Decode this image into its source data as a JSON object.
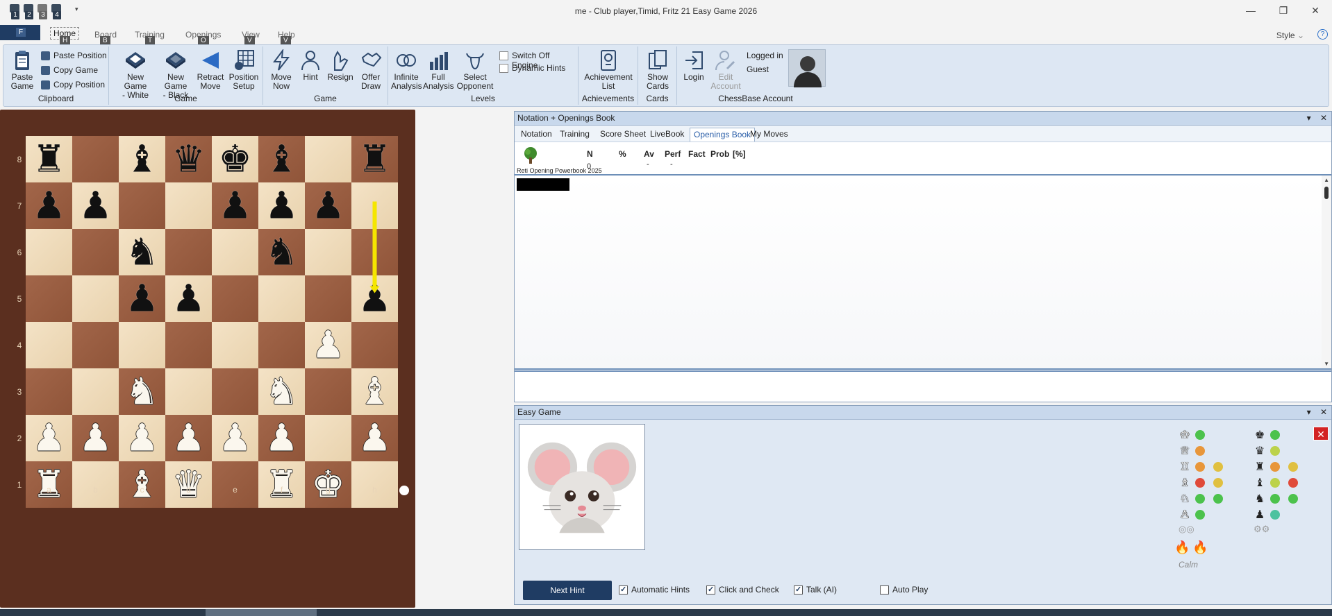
{
  "window": {
    "title": "me - Club player,Timid, Fritz 21 Easy Game 2026",
    "min_label": "—",
    "restore_label": "❐",
    "close_label": "✕"
  },
  "quick_access": [
    "1",
    "2",
    "3",
    "4"
  ],
  "ribbon_tabs": {
    "file_keytip": "F",
    "tabs": [
      {
        "label": "Home",
        "keytip": "H"
      },
      {
        "label": "Board",
        "keytip": "B"
      },
      {
        "label": "Training",
        "keytip": "T"
      },
      {
        "label": "Openings",
        "keytip": "O"
      },
      {
        "label": "View",
        "keytip": "V"
      },
      {
        "label": "Help",
        "keytip": "V"
      }
    ],
    "style_label": "Style",
    "style_chevron": "⌄",
    "help_label": "?"
  },
  "ribbon": {
    "clipboard": {
      "label": "Clipboard",
      "paste_game": [
        "Paste",
        "Game"
      ],
      "paste_position": "Paste Position",
      "copy_game": "Copy Game",
      "copy_position": "Copy Position"
    },
    "game": {
      "label": "Game",
      "new_white": [
        "New Game",
        "- White"
      ],
      "new_black": [
        "New Game",
        "- Black"
      ],
      "retract": [
        "Retract",
        "Move"
      ],
      "setup": [
        "Position",
        "Setup"
      ]
    },
    "game2": {
      "label": "Game",
      "move_now": [
        "Move",
        "Now"
      ],
      "hint": "Hint",
      "resign": "Resign",
      "offer_draw": [
        "Offer",
        "Draw"
      ]
    },
    "levels": {
      "label": "Levels",
      "infinite": [
        "Infinite",
        "Analysis"
      ],
      "full": [
        "Full",
        "Analysis"
      ],
      "select_opp": [
        "Select",
        "Opponent"
      ],
      "switch_off": "Switch Off Engine",
      "dynamic_hints": "Dynamic Hints"
    },
    "achievements": {
      "label": "Achievements",
      "list": [
        "Achievement",
        "List"
      ]
    },
    "cards": {
      "label": "Cards",
      "show": [
        "Show",
        "Cards"
      ]
    },
    "account": {
      "label": "ChessBase Account",
      "login": "Login",
      "edit": [
        "Edit",
        "Account"
      ],
      "logged_in": "Logged in",
      "user": "Guest"
    }
  },
  "board": {
    "ranks": [
      "8",
      "7",
      "6",
      "5",
      "4",
      "3",
      "2",
      "1"
    ],
    "files": [
      "a",
      "b",
      "c",
      "d",
      "e",
      "f",
      "g",
      "h"
    ],
    "position": [
      [
        "r",
        "",
        "b",
        "q",
        "k",
        "b",
        "",
        "r"
      ],
      [
        "p",
        "p",
        "",
        "",
        "p",
        "p",
        "p",
        ""
      ],
      [
        "",
        "",
        "n",
        "",
        "",
        "n",
        "",
        ""
      ],
      [
        "",
        "",
        "p",
        "p",
        "",
        "",
        "",
        "p"
      ],
      [
        "",
        "",
        "",
        "",
        "",
        "",
        "P",
        ""
      ],
      [
        "",
        "",
        "N",
        "",
        "",
        "N",
        "",
        "B"
      ],
      [
        "P",
        "P",
        "P",
        "P",
        "P",
        "P",
        "",
        "P"
      ],
      [
        "R",
        "",
        "B",
        "Q",
        "",
        "R",
        "K",
        ""
      ]
    ],
    "hint_arrow": {
      "from": "h7",
      "to": "h5",
      "color": "#f5e600"
    }
  },
  "notation_panel": {
    "title": "Notation + Openings Book",
    "tabs": [
      "Notation",
      "Training",
      "Score Sheet",
      "LiveBook",
      "Openings Book",
      "My Moves"
    ],
    "active_tab": "Openings Book",
    "columns": [
      "N",
      "%",
      "Av",
      "Perf",
      "Fact",
      "Prob",
      "[%]"
    ],
    "values": {
      "N": "0",
      "Av": "-",
      "Perf": "-"
    },
    "book_name": "Reti Opening Powerbook 2025"
  },
  "easy_panel": {
    "title": "Easy Game",
    "next_hint": "Next Hint",
    "options": [
      {
        "label": "Automatic Hints",
        "checked": true
      },
      {
        "label": "Click and Check",
        "checked": true
      },
      {
        "label": "Talk (AI)",
        "checked": true
      },
      {
        "label": "Auto Play",
        "checked": false
      }
    ],
    "mood": "Calm",
    "white_meter": [
      {
        "piece": "♔",
        "dots": [
          "#4cc24c"
        ]
      },
      {
        "piece": "♕",
        "dots": [
          "#e8963a"
        ]
      },
      {
        "piece": "♖",
        "dots": [
          "#e8963a",
          "#e0c040"
        ]
      },
      {
        "piece": "♗",
        "dots": [
          "#e04a3a",
          "#e0c040"
        ]
      },
      {
        "piece": "♘",
        "dots": [
          "#4cc24c",
          "#4cc24c"
        ]
      },
      {
        "piece": "♙",
        "dots": [
          "#4cc24c"
        ]
      }
    ],
    "black_meter": [
      {
        "piece": "♚",
        "dots": [
          "#4cc24c"
        ]
      },
      {
        "piece": "♛",
        "dots": [
          "#bcd24a"
        ]
      },
      {
        "piece": "♜",
        "dots": [
          "#e8963a",
          "#e0c040"
        ]
      },
      {
        "piece": "♝",
        "dots": [
          "#bcd24a",
          "#e04a3a"
        ]
      },
      {
        "piece": "♞",
        "dots": [
          "#4cc24c",
          "#4cc24c"
        ]
      },
      {
        "piece": "♟",
        "dots": [
          "#4cc2a0"
        ]
      }
    ],
    "flames": [
      "🔥",
      "🔥"
    ],
    "close_label": "✕"
  },
  "icons": {
    "paste": "clipboard-icon",
    "tree": "tree-icon",
    "mouse": "mouse-avatar"
  }
}
